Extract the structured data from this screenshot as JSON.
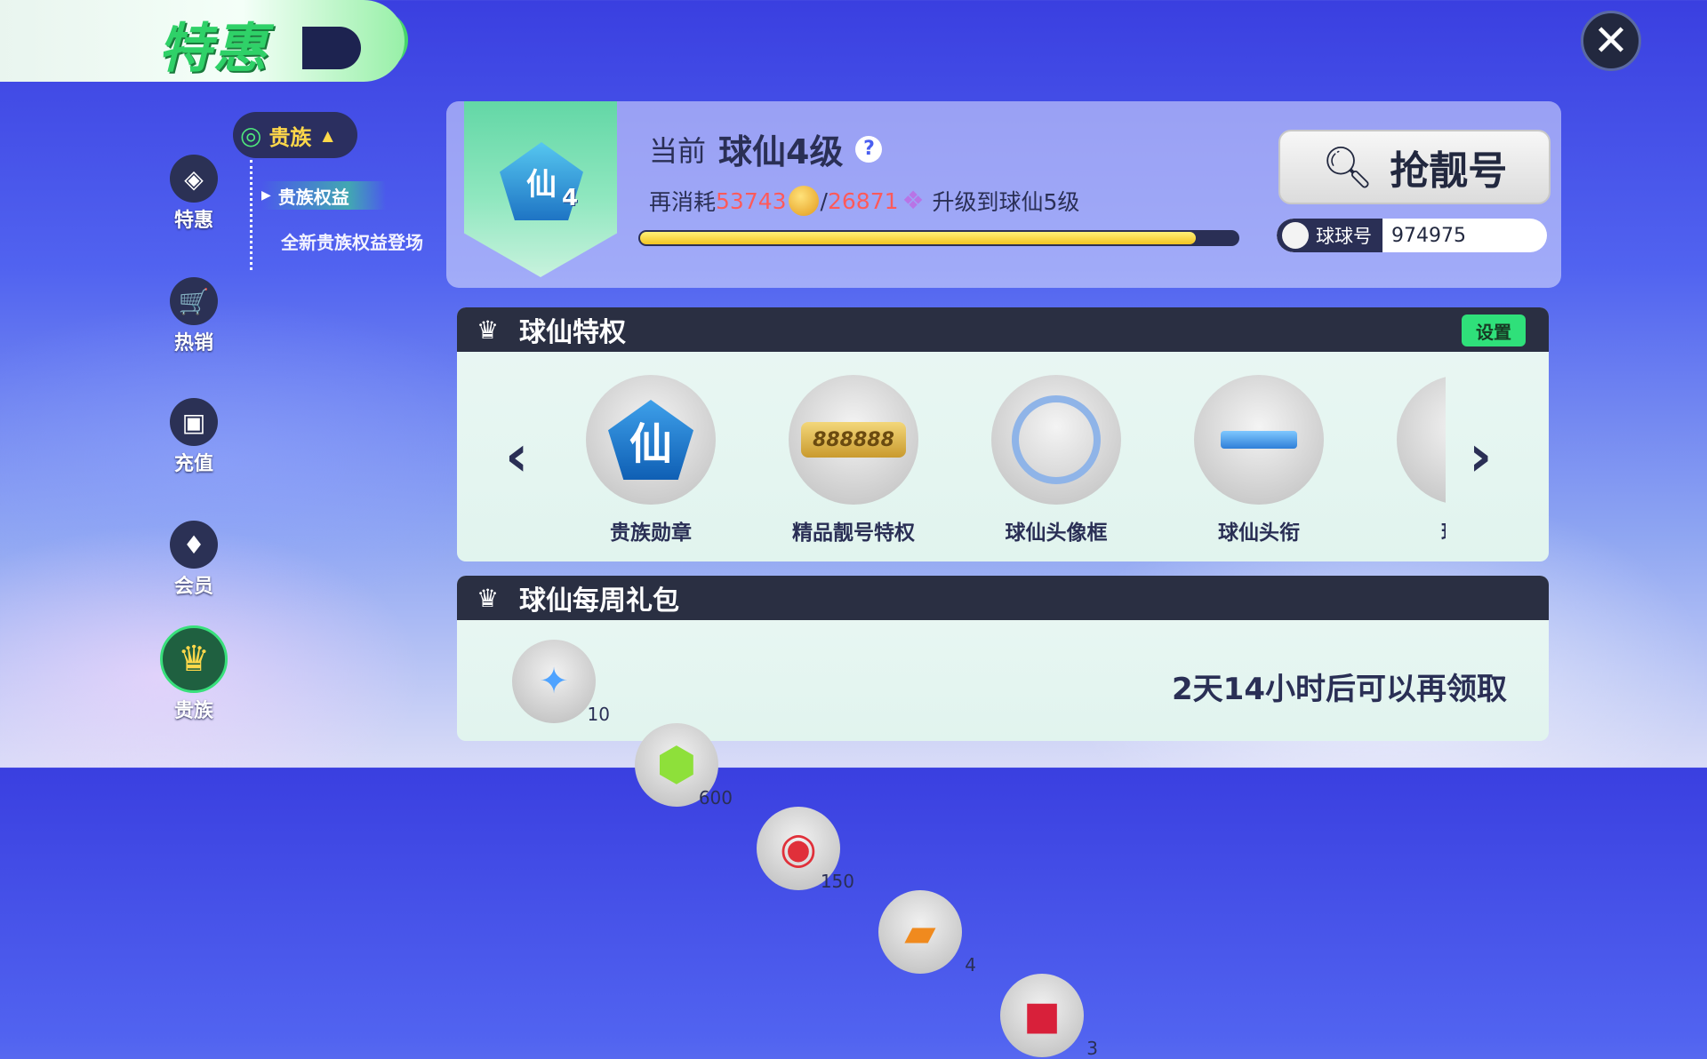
{
  "header": {
    "title": "特惠",
    "close_icon": "close-icon"
  },
  "nav": {
    "items": [
      {
        "label": "特惠",
        "icon": "tag-icon"
      },
      {
        "label": "热销",
        "icon": "cart-icon"
      },
      {
        "label": "充值",
        "icon": "wallet-icon"
      },
      {
        "label": "会员",
        "icon": "vip-icon"
      },
      {
        "label": "贵族",
        "icon": "crown-icon"
      }
    ],
    "active": "贵族"
  },
  "subnav": {
    "head": "贵族",
    "items": [
      "贵族权益",
      "全新贵族权益登场"
    ],
    "selected": "贵族权益"
  },
  "status": {
    "badge_char": "仙",
    "badge_level": "4",
    "current_prefix": "当前",
    "current_level": "球仙4级",
    "consume_prefix": "再消耗",
    "coin_amount": "53743",
    "separator": "/",
    "gem_amount": "26871",
    "upgrade_text": "升级到球仙5级",
    "progress": 0.93
  },
  "actions": {
    "grab_label": "抢靓号",
    "id_label": "球球号",
    "id_value": "974975"
  },
  "privileges": {
    "title": "球仙特权",
    "settings_label": "设置",
    "items": [
      "贵族勋章",
      "精品靓号特权",
      "球仙头像框",
      "球仙头衔",
      "球仙"
    ],
    "number_plate": "888888"
  },
  "weekly": {
    "title": "球仙每周礼包",
    "gifts": [
      {
        "count": "10",
        "icon": "wand-icon"
      },
      {
        "count": "600",
        "icon": "green-gem-icon"
      },
      {
        "count": "150",
        "icon": "lollipop-icon"
      },
      {
        "count": "4",
        "icon": "ticket-icon"
      },
      {
        "count": "3",
        "icon": "giftbox-icon"
      }
    ],
    "cooldown_text": "2天14小时后可以再领取"
  },
  "colors": {
    "accent_green": "#2fe07a",
    "title_green": "#2fd168",
    "warn_red": "#ff5a5a",
    "progress_yellow": "#f2c423",
    "dark_navy": "#2a2f42"
  }
}
